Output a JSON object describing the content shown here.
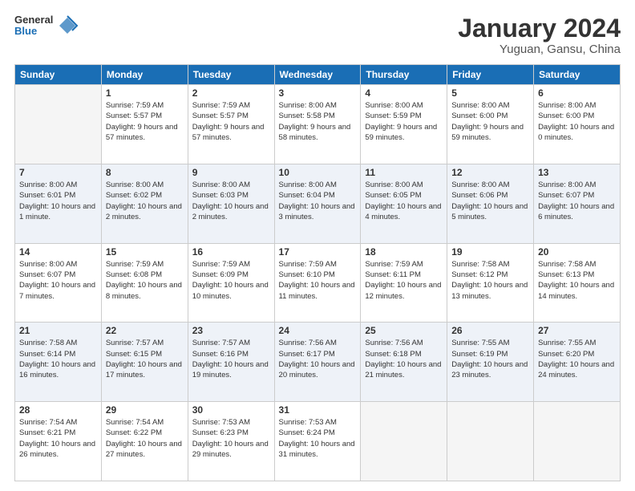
{
  "header": {
    "logo": {
      "general": "General",
      "blue": "Blue"
    },
    "title": "January 2024",
    "subtitle": "Yuguan, Gansu, China"
  },
  "calendar": {
    "days_of_week": [
      "Sunday",
      "Monday",
      "Tuesday",
      "Wednesday",
      "Thursday",
      "Friday",
      "Saturday"
    ],
    "weeks": [
      {
        "days": [
          {
            "num": "",
            "empty": true
          },
          {
            "num": "1",
            "sunrise": "Sunrise: 7:59 AM",
            "sunset": "Sunset: 5:57 PM",
            "daylight": "Daylight: 9 hours and 57 minutes."
          },
          {
            "num": "2",
            "sunrise": "Sunrise: 7:59 AM",
            "sunset": "Sunset: 5:57 PM",
            "daylight": "Daylight: 9 hours and 57 minutes."
          },
          {
            "num": "3",
            "sunrise": "Sunrise: 8:00 AM",
            "sunset": "Sunset: 5:58 PM",
            "daylight": "Daylight: 9 hours and 58 minutes."
          },
          {
            "num": "4",
            "sunrise": "Sunrise: 8:00 AM",
            "sunset": "Sunset: 5:59 PM",
            "daylight": "Daylight: 9 hours and 59 minutes."
          },
          {
            "num": "5",
            "sunrise": "Sunrise: 8:00 AM",
            "sunset": "Sunset: 6:00 PM",
            "daylight": "Daylight: 9 hours and 59 minutes."
          },
          {
            "num": "6",
            "sunrise": "Sunrise: 8:00 AM",
            "sunset": "Sunset: 6:00 PM",
            "daylight": "Daylight: 10 hours and 0 minutes."
          }
        ]
      },
      {
        "days": [
          {
            "num": "7",
            "sunrise": "Sunrise: 8:00 AM",
            "sunset": "Sunset: 6:01 PM",
            "daylight": "Daylight: 10 hours and 1 minute."
          },
          {
            "num": "8",
            "sunrise": "Sunrise: 8:00 AM",
            "sunset": "Sunset: 6:02 PM",
            "daylight": "Daylight: 10 hours and 2 minutes."
          },
          {
            "num": "9",
            "sunrise": "Sunrise: 8:00 AM",
            "sunset": "Sunset: 6:03 PM",
            "daylight": "Daylight: 10 hours and 2 minutes."
          },
          {
            "num": "10",
            "sunrise": "Sunrise: 8:00 AM",
            "sunset": "Sunset: 6:04 PM",
            "daylight": "Daylight: 10 hours and 3 minutes."
          },
          {
            "num": "11",
            "sunrise": "Sunrise: 8:00 AM",
            "sunset": "Sunset: 6:05 PM",
            "daylight": "Daylight: 10 hours and 4 minutes."
          },
          {
            "num": "12",
            "sunrise": "Sunrise: 8:00 AM",
            "sunset": "Sunset: 6:06 PM",
            "daylight": "Daylight: 10 hours and 5 minutes."
          },
          {
            "num": "13",
            "sunrise": "Sunrise: 8:00 AM",
            "sunset": "Sunset: 6:07 PM",
            "daylight": "Daylight: 10 hours and 6 minutes."
          }
        ]
      },
      {
        "days": [
          {
            "num": "14",
            "sunrise": "Sunrise: 8:00 AM",
            "sunset": "Sunset: 6:07 PM",
            "daylight": "Daylight: 10 hours and 7 minutes."
          },
          {
            "num": "15",
            "sunrise": "Sunrise: 7:59 AM",
            "sunset": "Sunset: 6:08 PM",
            "daylight": "Daylight: 10 hours and 8 minutes."
          },
          {
            "num": "16",
            "sunrise": "Sunrise: 7:59 AM",
            "sunset": "Sunset: 6:09 PM",
            "daylight": "Daylight: 10 hours and 10 minutes."
          },
          {
            "num": "17",
            "sunrise": "Sunrise: 7:59 AM",
            "sunset": "Sunset: 6:10 PM",
            "daylight": "Daylight: 10 hours and 11 minutes."
          },
          {
            "num": "18",
            "sunrise": "Sunrise: 7:59 AM",
            "sunset": "Sunset: 6:11 PM",
            "daylight": "Daylight: 10 hours and 12 minutes."
          },
          {
            "num": "19",
            "sunrise": "Sunrise: 7:58 AM",
            "sunset": "Sunset: 6:12 PM",
            "daylight": "Daylight: 10 hours and 13 minutes."
          },
          {
            "num": "20",
            "sunrise": "Sunrise: 7:58 AM",
            "sunset": "Sunset: 6:13 PM",
            "daylight": "Daylight: 10 hours and 14 minutes."
          }
        ]
      },
      {
        "days": [
          {
            "num": "21",
            "sunrise": "Sunrise: 7:58 AM",
            "sunset": "Sunset: 6:14 PM",
            "daylight": "Daylight: 10 hours and 16 minutes."
          },
          {
            "num": "22",
            "sunrise": "Sunrise: 7:57 AM",
            "sunset": "Sunset: 6:15 PM",
            "daylight": "Daylight: 10 hours and 17 minutes."
          },
          {
            "num": "23",
            "sunrise": "Sunrise: 7:57 AM",
            "sunset": "Sunset: 6:16 PM",
            "daylight": "Daylight: 10 hours and 19 minutes."
          },
          {
            "num": "24",
            "sunrise": "Sunrise: 7:56 AM",
            "sunset": "Sunset: 6:17 PM",
            "daylight": "Daylight: 10 hours and 20 minutes."
          },
          {
            "num": "25",
            "sunrise": "Sunrise: 7:56 AM",
            "sunset": "Sunset: 6:18 PM",
            "daylight": "Daylight: 10 hours and 21 minutes."
          },
          {
            "num": "26",
            "sunrise": "Sunrise: 7:55 AM",
            "sunset": "Sunset: 6:19 PM",
            "daylight": "Daylight: 10 hours and 23 minutes."
          },
          {
            "num": "27",
            "sunrise": "Sunrise: 7:55 AM",
            "sunset": "Sunset: 6:20 PM",
            "daylight": "Daylight: 10 hours and 24 minutes."
          }
        ]
      },
      {
        "days": [
          {
            "num": "28",
            "sunrise": "Sunrise: 7:54 AM",
            "sunset": "Sunset: 6:21 PM",
            "daylight": "Daylight: 10 hours and 26 minutes."
          },
          {
            "num": "29",
            "sunrise": "Sunrise: 7:54 AM",
            "sunset": "Sunset: 6:22 PM",
            "daylight": "Daylight: 10 hours and 27 minutes."
          },
          {
            "num": "30",
            "sunrise": "Sunrise: 7:53 AM",
            "sunset": "Sunset: 6:23 PM",
            "daylight": "Daylight: 10 hours and 29 minutes."
          },
          {
            "num": "31",
            "sunrise": "Sunrise: 7:53 AM",
            "sunset": "Sunset: 6:24 PM",
            "daylight": "Daylight: 10 hours and 31 minutes."
          },
          {
            "num": "",
            "empty": true
          },
          {
            "num": "",
            "empty": true
          },
          {
            "num": "",
            "empty": true
          }
        ]
      }
    ]
  }
}
